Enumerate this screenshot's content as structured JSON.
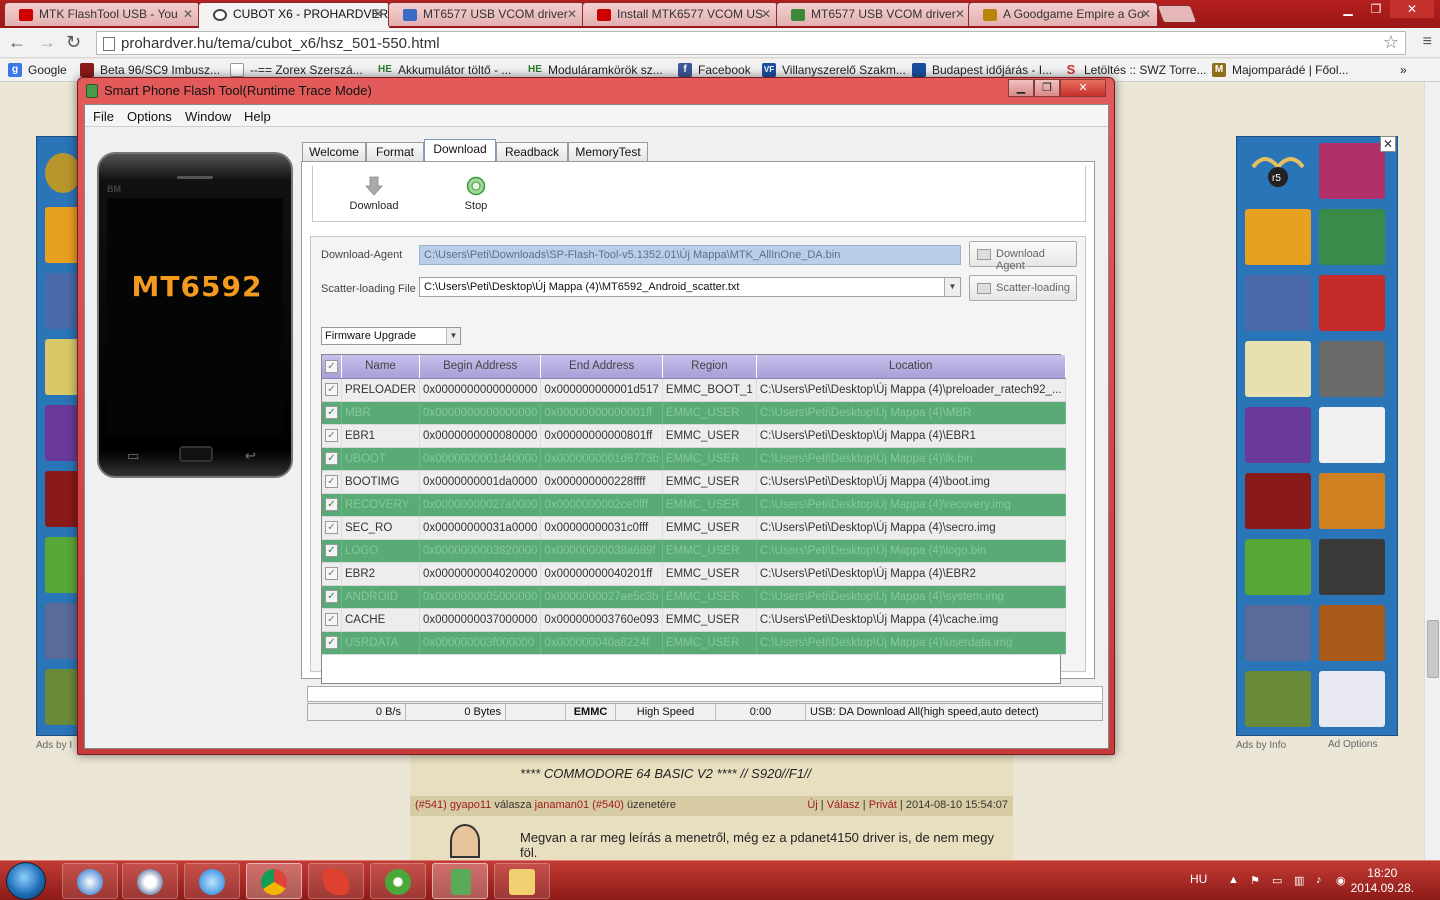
{
  "browser": {
    "tabs": [
      {
        "label": "MTK FlashTool USB - You",
        "color": "#cc0000"
      },
      {
        "label": "CUBOT X6 - PROHARDVER",
        "color": "#444444",
        "active": true
      },
      {
        "label": "MT6577 USB VCOM driver",
        "color": "#3b6bc5"
      },
      {
        "label": "Install MTK6577 VCOM US",
        "color": "#cc0000"
      },
      {
        "label": "MT6577 USB VCOM driver",
        "color": "#3a8a3a"
      },
      {
        "label": "A Goodgame Empire a Go",
        "color": "#b8860b"
      }
    ],
    "url": "prohardver.hu/tema/cubot_x6/hsz_501-550.html",
    "bookmarks": [
      {
        "label": "Google",
        "icon": "g-icon",
        "color": "#3b78e7",
        "glyph": "g"
      },
      {
        "label": "Beta 96/SC9 Imbusz...",
        "icon": "bookmark-icon",
        "color": "#8b1a1a",
        "glyph": ""
      },
      {
        "label": "--== Zorex Szerszá...",
        "icon": "page-icon",
        "color": "#bbbbbb",
        "glyph": ""
      },
      {
        "label": "Akkumulátor töltő - ...",
        "icon": "he-icon",
        "color": "#2e7d32",
        "glyph": "HE"
      },
      {
        "label": "Moduláramkörök sz...",
        "icon": "he-icon",
        "color": "#2e7d32",
        "glyph": "HE"
      },
      {
        "label": "Facebook",
        "icon": "facebook-icon",
        "color": "#3b5998",
        "glyph": "f"
      },
      {
        "label": "Villanyszerelő Szakm...",
        "icon": "vf-icon",
        "color": "#1e4fa0",
        "glyph": "VF"
      },
      {
        "label": "Budapest időjárás - I...",
        "icon": "weather-icon",
        "color": "#1a4fa0",
        "glyph": ""
      },
      {
        "label": "Letöltés :: SWZ Torre...",
        "icon": "s-icon",
        "color": "#d32f2f",
        "glyph": "S"
      },
      {
        "label": "Majomparádé | Főol...",
        "icon": "m-icon",
        "color": "#8d6e1a",
        "glyph": "M"
      }
    ]
  },
  "webpage": {
    "ads_by_info": "Ads by Info",
    "ads_by_left": "Ads by I",
    "ad_options": "Ad Options",
    "forum_banner": "**** COMMODORE 64 BASIC V2 **** // S920//F1//",
    "post_head": {
      "post_number": "(#541)",
      "author": "gyapo11",
      "reply_word": "válasza",
      "reply_to": "janaman01",
      "reply_post": "(#540)",
      "suffix": "üzenetére",
      "new": "Új",
      "reply": "Válasz",
      "private": "Privát",
      "timestamp": "2014-08-10 15:54:07"
    },
    "post_text": "Megvan a rar meg leírás a menetről, még ez a pdanet4150 driver is, de nem megy föl."
  },
  "sp_tool": {
    "title": "Smart Phone Flash Tool(Runtime Trace Mode)",
    "menu": [
      "File",
      "Options",
      "Window",
      "Help"
    ],
    "phone": {
      "brand": "BM",
      "chip": "MT6592"
    },
    "tabs": [
      "Welcome",
      "Format",
      "Download",
      "Readback",
      "MemoryTest"
    ],
    "active_tab": "Download",
    "toolbar": {
      "download_label": "Download",
      "stop_label": "Stop"
    },
    "download_agent": {
      "label": "Download-Agent",
      "value": "C:\\Users\\Peti\\Downloads\\SP-Flash-Tool-v5.1352.01\\Új Mappa\\MTK_AllInOne_DA.bin",
      "button": "Download Agent"
    },
    "scatter": {
      "label": "Scatter-loading File",
      "value": "C:\\Users\\Peti\\Desktop\\Új Mappa (4)\\MT6592_Android_scatter.txt",
      "button": "Scatter-loading"
    },
    "mode": "Firmware Upgrade",
    "columns": [
      "Name",
      "Begin Address",
      "End Address",
      "Region",
      "Location"
    ],
    "rows": [
      {
        "name": "PRELOADER",
        "begin": "0x0000000000000000",
        "end": "0x000000000001d517",
        "region": "EMMC_BOOT_1",
        "location": "C:\\Users\\Peti\\Desktop\\Új Mappa (4)\\preloader_ratech92_..."
      },
      {
        "name": "MBR",
        "begin": "0x0000000000000000",
        "end": "0x00000000000001ff",
        "region": "EMMC_USER",
        "location": "C:\\Users\\Peti\\Desktop\\Új Mappa (4)\\MBR"
      },
      {
        "name": "EBR1",
        "begin": "0x0000000000080000",
        "end": "0x00000000000801ff",
        "region": "EMMC_USER",
        "location": "C:\\Users\\Peti\\Desktop\\Új Mappa (4)\\EBR1"
      },
      {
        "name": "UBOOT",
        "begin": "0x0000000001d40000",
        "end": "0x0000000001d8773b",
        "region": "EMMC_USER",
        "location": "C:\\Users\\Peti\\Desktop\\Új Mappa (4)\\lk.bin"
      },
      {
        "name": "BOOTIMG",
        "begin": "0x0000000001da0000",
        "end": "0x000000000228ffff",
        "region": "EMMC_USER",
        "location": "C:\\Users\\Peti\\Desktop\\Új Mappa (4)\\boot.img"
      },
      {
        "name": "RECOVERY",
        "begin": "0x00000000027a0000",
        "end": "0x0000000002ce0fff",
        "region": "EMMC_USER",
        "location": "C:\\Users\\Peti\\Desktop\\Új Mappa (4)\\recovery.img"
      },
      {
        "name": "SEC_RO",
        "begin": "0x00000000031a0000",
        "end": "0x00000000031c0fff",
        "region": "EMMC_USER",
        "location": "C:\\Users\\Peti\\Desktop\\Új Mappa (4)\\secro.img"
      },
      {
        "name": "LOGO",
        "begin": "0x0000000003820000",
        "end": "0x00000000038a689f",
        "region": "EMMC_USER",
        "location": "C:\\Users\\Peti\\Desktop\\Új Mappa (4)\\logo.bin"
      },
      {
        "name": "EBR2",
        "begin": "0x0000000004020000",
        "end": "0x00000000040201ff",
        "region": "EMMC_USER",
        "location": "C:\\Users\\Peti\\Desktop\\Új Mappa (4)\\EBR2"
      },
      {
        "name": "ANDROID",
        "begin": "0x0000000005000000",
        "end": "0x0000000027ae5c3b",
        "region": "EMMC_USER",
        "location": "C:\\Users\\Peti\\Desktop\\Új Mappa (4)\\system.img"
      },
      {
        "name": "CACHE",
        "begin": "0x0000000037000000",
        "end": "0x000000003760e093",
        "region": "EMMC_USER",
        "location": "C:\\Users\\Peti\\Desktop\\Új Mappa (4)\\cache.img"
      },
      {
        "name": "USRDATA",
        "begin": "0x000000003f000000",
        "end": "0x000000040a8224f",
        "region": "EMMC_USER",
        "location": "C:\\Users\\Peti\\Desktop\\Új Mappa (4)\\userdata.img"
      }
    ],
    "status": {
      "speed": "0 B/s",
      "bytes": "0 Bytes",
      "storage": "EMMC",
      "usb_speed": "High Speed",
      "time": "0:00",
      "message": "USB: DA Download All(high speed,auto detect)"
    },
    "colors": {
      "checked_row": "#5aaa78",
      "header": "#a79fd6",
      "chip_text": "#f39a1f"
    }
  },
  "taskbar": {
    "language": "HU",
    "time": "18:20",
    "date": "2014.09.28."
  }
}
